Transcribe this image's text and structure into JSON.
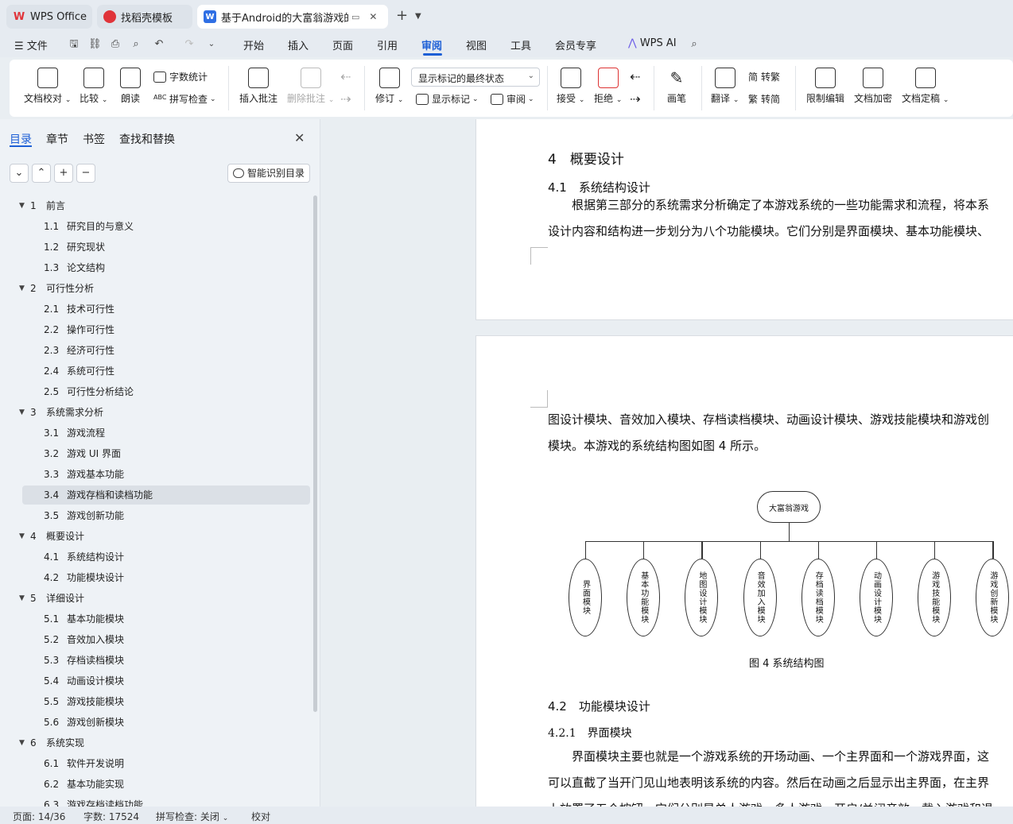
{
  "tabs": [
    {
      "label": "WPS Office",
      "icon": "wps-logo-icon"
    },
    {
      "label": "找稻壳模板",
      "icon": "docer-icon"
    },
    {
      "label": "基于Android的大富翁游戏的设",
      "icon": "writer-icon"
    }
  ],
  "menu": {
    "file": "文件",
    "items": [
      "开始",
      "插入",
      "页面",
      "引用",
      "审阅",
      "视图",
      "工具",
      "会员专享"
    ],
    "active": "审阅",
    "ai": "WPS AI"
  },
  "ribbon": {
    "doc_check": "文档校对",
    "compare": "比较",
    "read_aloud": "朗读",
    "word_count": "字数统计",
    "spell_check": "拼写检查",
    "insert_comment": "插入批注",
    "delete_comment": "删除批注",
    "track": "修订",
    "markup_state": "显示标记的最终状态",
    "show_markup": "显示标记",
    "review": "审阅",
    "accept": "接受",
    "reject": "拒绝",
    "pen": "画笔",
    "translate": "翻译",
    "to_traditional": "转繁",
    "to_simplified": "转简",
    "restrict_edit": "限制编辑",
    "encrypt": "文档加密",
    "finalize": "文档定稿"
  },
  "nav": {
    "tabs": [
      "目录",
      "章节",
      "书签",
      "查找和替换"
    ],
    "smart_toc": "智能识别目录",
    "toc": [
      {
        "num": "1",
        "title": "前言",
        "level": 1
      },
      {
        "num": "1.1",
        "title": "研究目的与意义",
        "level": 2
      },
      {
        "num": "1.2",
        "title": "研究现状",
        "level": 2
      },
      {
        "num": "1.3",
        "title": "论文结构",
        "level": 2
      },
      {
        "num": "2",
        "title": "可行性分析",
        "level": 1
      },
      {
        "num": "2.1",
        "title": "技术可行性",
        "level": 2
      },
      {
        "num": "2.2",
        "title": "操作可行性",
        "level": 2
      },
      {
        "num": "2.3",
        "title": "经济可行性",
        "level": 2
      },
      {
        "num": "2.4",
        "title": "系统可行性",
        "level": 2
      },
      {
        "num": "2.5",
        "title": "可行性分析结论",
        "level": 2
      },
      {
        "num": "3",
        "title": "系统需求分析",
        "level": 1
      },
      {
        "num": "3.1",
        "title": "游戏流程",
        "level": 2
      },
      {
        "num": "3.2",
        "title": "游戏 UI 界面",
        "level": 2
      },
      {
        "num": "3.3",
        "title": "游戏基本功能",
        "level": 2
      },
      {
        "num": "3.4",
        "title": "游戏存档和读档功能",
        "level": 2,
        "selected": true
      },
      {
        "num": "3.5",
        "title": "游戏创新功能",
        "level": 2
      },
      {
        "num": "4",
        "title": "概要设计",
        "level": 1
      },
      {
        "num": "4.1",
        "title": "系统结构设计",
        "level": 2
      },
      {
        "num": "4.2",
        "title": "功能模块设计",
        "level": 2
      },
      {
        "num": "5",
        "title": "详细设计",
        "level": 1
      },
      {
        "num": "5.1",
        "title": "基本功能模块",
        "level": 2
      },
      {
        "num": "5.2",
        "title": "音效加入模块",
        "level": 2
      },
      {
        "num": "5.3",
        "title": "存档读档模块",
        "level": 2
      },
      {
        "num": "5.4",
        "title": "动画设计模块",
        "level": 2
      },
      {
        "num": "5.5",
        "title": "游戏技能模块",
        "level": 2
      },
      {
        "num": "5.6",
        "title": "游戏创新模块",
        "level": 2
      },
      {
        "num": "6",
        "title": "系统实现",
        "level": 1
      },
      {
        "num": "6.1",
        "title": "软件开发说明",
        "level": 2
      },
      {
        "num": "6.2",
        "title": "基本功能实现",
        "level": 2
      },
      {
        "num": "6.3",
        "title": "游戏存档读档功能",
        "level": 2
      }
    ]
  },
  "document": {
    "h1": "4　概要设计",
    "h2_1": "4.1　系统结构设计",
    "p1_line1": "根据第三部分的系统需求分析确定了本游戏系统的一些功能需求和流程，将本系",
    "p1_line2": "设计内容和结构进一步划分为八个功能模块。它们分别是界面模块、基本功能模块、",
    "p2_line1": "图设计模块、音效加入模块、存档读档模块、动画设计模块、游戏技能模块和游戏创",
    "p2_line2": "模块。本游戏的系统结构图如图 4 所示。",
    "diagram_root": "大富翁游戏",
    "diagram_modules": [
      "界面模块",
      "基本功能模块",
      "地图设计模块",
      "音效加入模块",
      "存档读档模块",
      "动画设计模块",
      "游戏技能模块",
      "游戏创新模块"
    ],
    "figure_caption": "图 4  系统结构图",
    "h2_2": "4.2　功能模块设计",
    "h3": "4.2.1　界面模块",
    "p3_line1": "界面模块主要也就是一个游戏系统的开场动画、一个主界面和一个游戏界面，这",
    "p3_line2": "可以直截了当开门见山地表明该系统的内容。然后在动画之后显示出主界面，在主界",
    "p3_line3": "上放置了五个按钮，它们分别是单人游戏、多人游戏、开启/关闭音效、载入游戏和退"
  },
  "status": {
    "page": "页面: 14/36",
    "words": "字数: 17524",
    "spell": "拼写检查: 关闭",
    "proof": "校对"
  },
  "colors": {
    "accent": "#1d5fd6",
    "wps_red": "#e0343a",
    "writer_blue": "#2f6fe4"
  }
}
